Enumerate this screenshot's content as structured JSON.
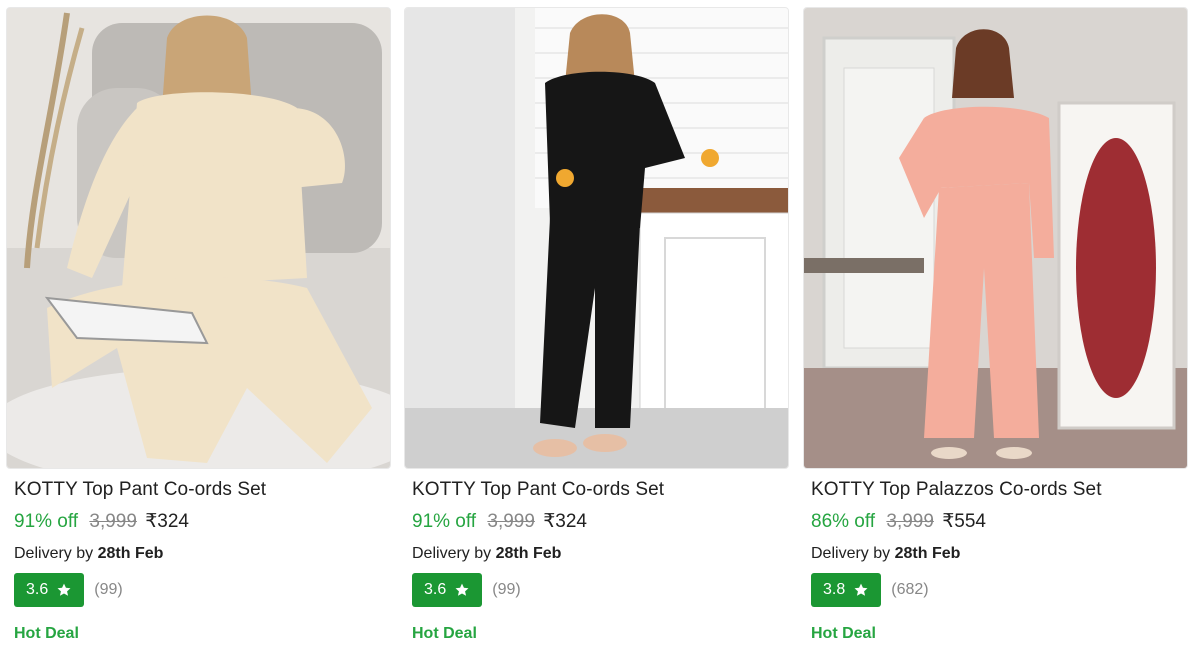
{
  "products": [
    {
      "title": "KOTTY Top Pant Co-ords Set",
      "discount": "91% off",
      "mrp": "3,999",
      "price": "₹324",
      "delivery_prefix": "Delivery by",
      "delivery_date": "28th Feb",
      "rating": "3.6",
      "rating_count": "(99)",
      "badge": "Hot Deal",
      "image_icon": "beige-co-ords-photo",
      "outfit_color": "#f1e3c8"
    },
    {
      "title": "KOTTY Top Pant Co-ords Set",
      "discount": "91% off",
      "mrp": "3,999",
      "price": "₹324",
      "delivery_prefix": "Delivery by",
      "delivery_date": "28th Feb",
      "rating": "3.6",
      "rating_count": "(99)",
      "badge": "Hot Deal",
      "image_icon": "black-co-ords-photo",
      "outfit_color": "#161616"
    },
    {
      "title": "KOTTY Top Palazzos Co-ords Set",
      "discount": "86% off",
      "mrp": "3,999",
      "price": "₹554",
      "delivery_prefix": "Delivery by",
      "delivery_date": "28th Feb",
      "rating": "3.8",
      "rating_count": "(682)",
      "badge": "Hot Deal",
      "image_icon": "pink-co-ords-photo",
      "outfit_color": "#f4ad9c"
    }
  ],
  "colors": {
    "discount_green": "#26a541",
    "rating_badge_green": "#1b9733",
    "text_primary": "#212121",
    "text_muted": "#878787"
  }
}
